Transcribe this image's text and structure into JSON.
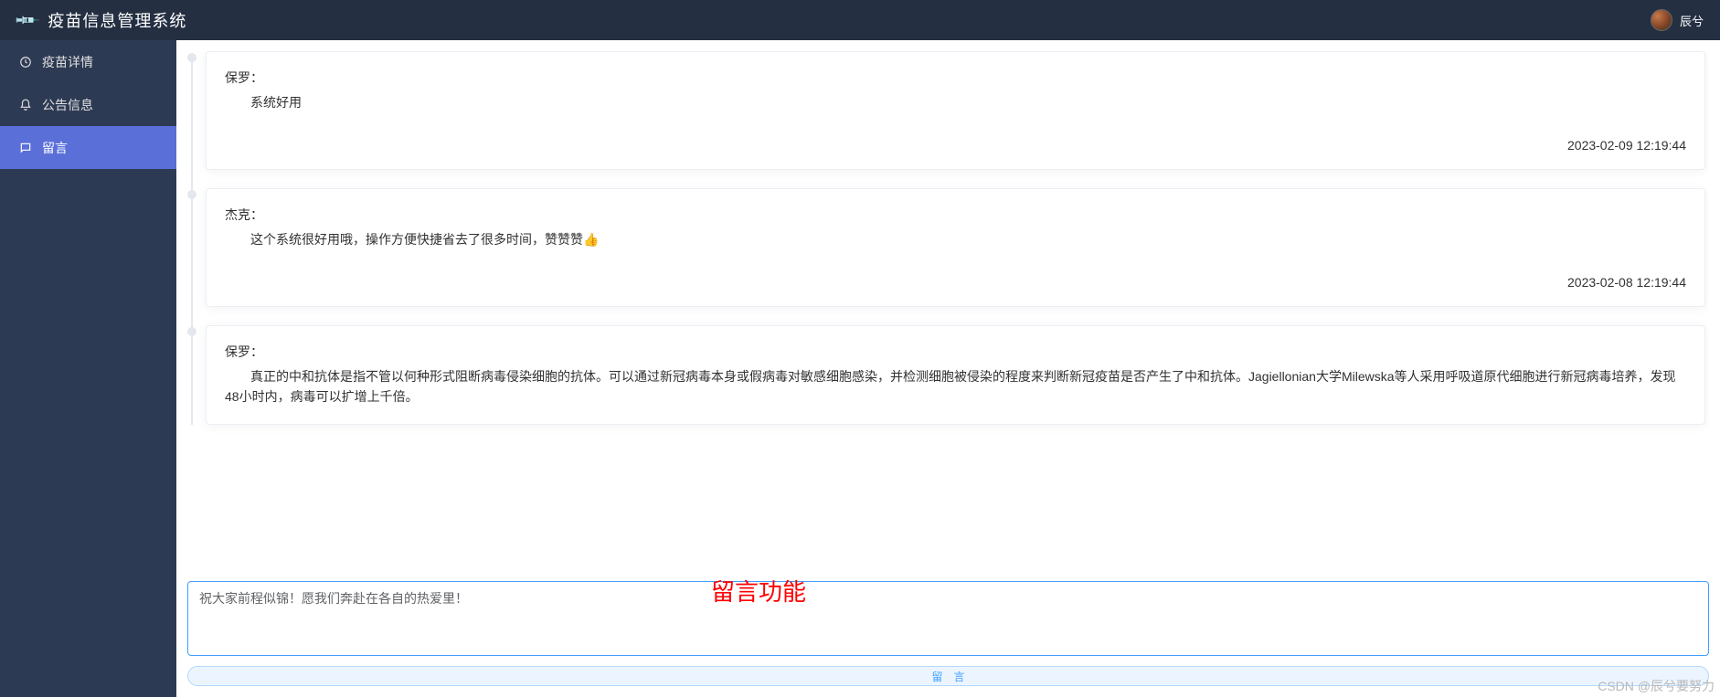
{
  "header": {
    "title": "疫苗信息管理系统",
    "username": "辰兮"
  },
  "sidebar": {
    "items": [
      {
        "icon": "⊙",
        "label": "疫苗详情"
      },
      {
        "icon": "🔔",
        "label": "公告信息"
      },
      {
        "icon": "💬",
        "label": "留言"
      }
    ]
  },
  "timeline": [
    {
      "author": "保罗：",
      "content": "系统好用",
      "time": "2023-02-09 12:19:44"
    },
    {
      "author": "杰克：",
      "content": "这个系统很好用哦，操作方便快捷省去了很多时间，赞赞赞👍",
      "time": "2023-02-08 12:19:44"
    },
    {
      "author": "保罗：",
      "content": "真正的中和抗体是指不管以何种形式阻断病毒侵染细胞的抗体。可以通过新冠病毒本身或假病毒对敏感细胞感染，并检测细胞被侵染的程度来判断新冠疫苗是否产生了中和抗体。Jagiellonian大学Milewska等人采用呼吸道原代细胞进行新冠病毒培养，发现48小时内，病毒可以扩增上千倍。",
      "time": ""
    }
  ],
  "messageBox": {
    "value": "祝大家前程似锦！愿我们奔赴在各自的热爱里！",
    "submitLabel": "留言"
  },
  "annotation": "留言功能",
  "watermark": "CSDN @辰兮要努力"
}
